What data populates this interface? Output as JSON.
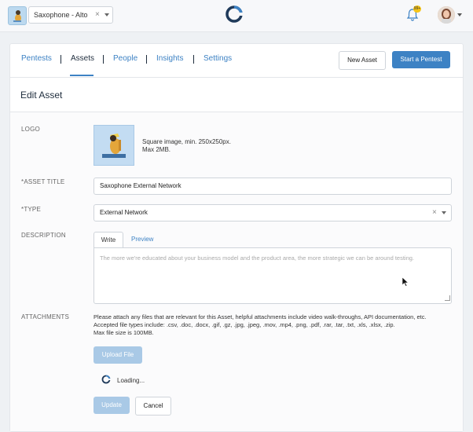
{
  "topbar": {
    "org_select": {
      "value": "Saxophone - Alto",
      "clear": "×"
    },
    "notifications": {
      "badge": "99+"
    }
  },
  "nav": {
    "tabs": [
      {
        "label": "Pentests"
      },
      {
        "label": "Assets"
      },
      {
        "label": "People"
      },
      {
        "label": "Insights"
      },
      {
        "label": "Settings"
      }
    ],
    "active_tab": "Assets",
    "new_asset_label": "New Asset",
    "start_pentest_label": "Start a Pentest"
  },
  "page": {
    "title": "Edit Asset"
  },
  "form": {
    "logo": {
      "label": "LOGO",
      "help_line1": "Square image, min. 250x250px.",
      "help_line2": "Max 2MB."
    },
    "asset_title": {
      "label": "*ASSET TITLE",
      "value": "Saxophone External Network"
    },
    "type": {
      "label": "*TYPE",
      "value": "External Network",
      "clear": "×"
    },
    "description": {
      "label": "DESCRIPTION",
      "tab_write": "Write",
      "tab_preview": "Preview",
      "placeholder": "The more we're educated about your business model and the product area, the more strategic we can be around testing."
    },
    "attachments": {
      "label": "ATTACHMENTS",
      "line1": "Please attach any files that are relevant for this Asset, helpful attachments include video walk-throughs, API documentation, etc.",
      "line2": "Accepted file types include: .csv, .doc, .docx, .gif, .gz, .jpg, .jpeg, .mov, .mp4, .png, .pdf, .rar, .tar, .txt, .xls, .xlsx, .zip.",
      "line3": "Max file size is 100MB.",
      "upload_label": "Upload File",
      "loading_text": "Loading..."
    },
    "update_label": "Update",
    "cancel_label": "Cancel"
  },
  "colors": {
    "accent": "#3d82c4",
    "accent_disabled": "#a9c9e6",
    "badge": "#f5c518"
  },
  "icons": {
    "brand": "cobalt-logo-icon",
    "bell": "bell-icon",
    "loading": "cobalt-spinner-icon"
  }
}
